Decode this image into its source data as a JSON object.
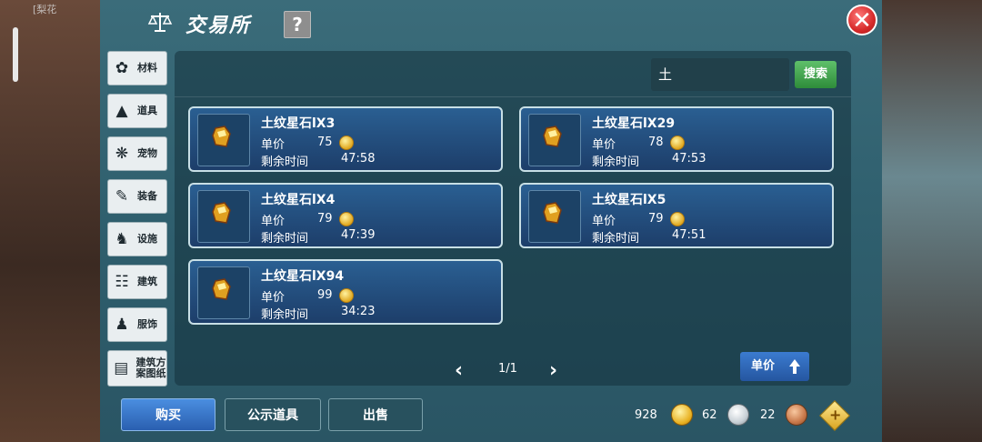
{
  "header": {
    "title": "交易所",
    "help_label": "?",
    "close_label": "✕"
  },
  "background": {
    "side_text": "[梨花"
  },
  "sidebar": {
    "items": [
      {
        "label": "材料",
        "icon": "material-icon"
      },
      {
        "label": "道具",
        "icon": "item-icon"
      },
      {
        "label": "宠物",
        "icon": "paw-icon"
      },
      {
        "label": "装备",
        "icon": "equipment-icon"
      },
      {
        "label": "设施",
        "icon": "facility-icon"
      },
      {
        "label": "建筑",
        "icon": "building-icon"
      },
      {
        "label": "服饰",
        "icon": "clothing-icon"
      },
      {
        "label": "建筑方案图纸",
        "icon": "blueprint-icon"
      }
    ]
  },
  "search": {
    "value": "土",
    "button_label": "搜索"
  },
  "listings": [
    {
      "name": "土纹星石lX3",
      "price_label": "单价",
      "price": "75",
      "time_label": "剩余时间",
      "time": "47:58"
    },
    {
      "name": "土纹星石lX29",
      "price_label": "单价",
      "price": "78",
      "time_label": "剩余时间",
      "time": "47:53"
    },
    {
      "name": "土纹星石lX4",
      "price_label": "单价",
      "price": "79",
      "time_label": "剩余时间",
      "time": "47:39"
    },
    {
      "name": "土纹星石lX5",
      "price_label": "单价",
      "price": "79",
      "time_label": "剩余时间",
      "time": "47:51"
    },
    {
      "name": "土纹星石lX94",
      "price_label": "单价",
      "price": "99",
      "time_label": "剩余时间",
      "time": "34:23"
    }
  ],
  "pager": {
    "prev": "‹",
    "next": "›",
    "text": "1/1"
  },
  "sort": {
    "label": "单价"
  },
  "bottom_tabs": {
    "buy": "购买",
    "public": "公示道具",
    "sell": "出售"
  },
  "currency": {
    "gold": "928",
    "silver": "62",
    "copper": "22"
  },
  "colors": {
    "accent": "#2a5fb0",
    "search_green": "#2e8c3a",
    "close_red": "#d62a2a"
  }
}
